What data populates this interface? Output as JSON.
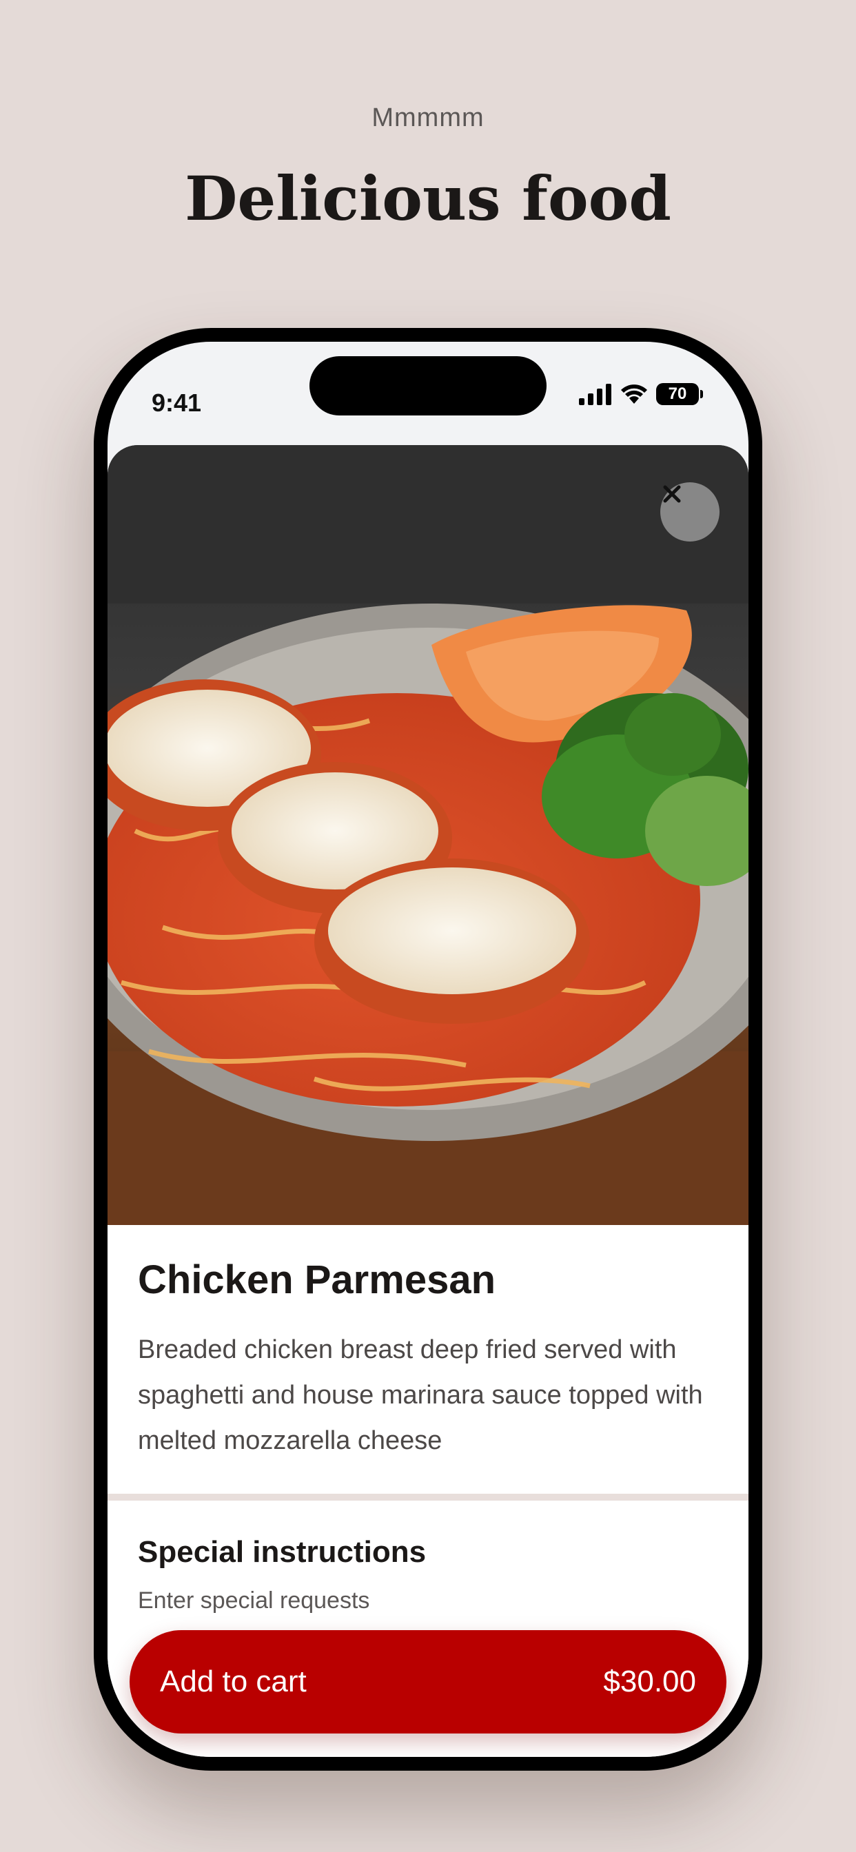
{
  "header": {
    "eyebrow": "Mmmmm",
    "title": "Delicious food"
  },
  "status_bar": {
    "time": "9:41",
    "battery_level": "70",
    "icons": [
      "cellular-signal-icon",
      "wifi-icon",
      "battery-icon"
    ]
  },
  "item": {
    "image_subject": "chicken-parmesan-plate-image",
    "close_icon": "close-icon",
    "name": "Chicken Parmesan",
    "description": "Breaded chicken breast deep fried served with spaghetti and house marinara sauce topped with melted mozzarella cheese"
  },
  "special_instructions": {
    "title": "Special instructions",
    "placeholder": "Enter special requests"
  },
  "cart_button": {
    "label": "Add to cart",
    "price": "$30.00"
  },
  "colors": {
    "page_background": "#e4dad7",
    "accent": "#b90000",
    "text_primary": "#1b1817",
    "text_secondary": "#4c4847"
  }
}
